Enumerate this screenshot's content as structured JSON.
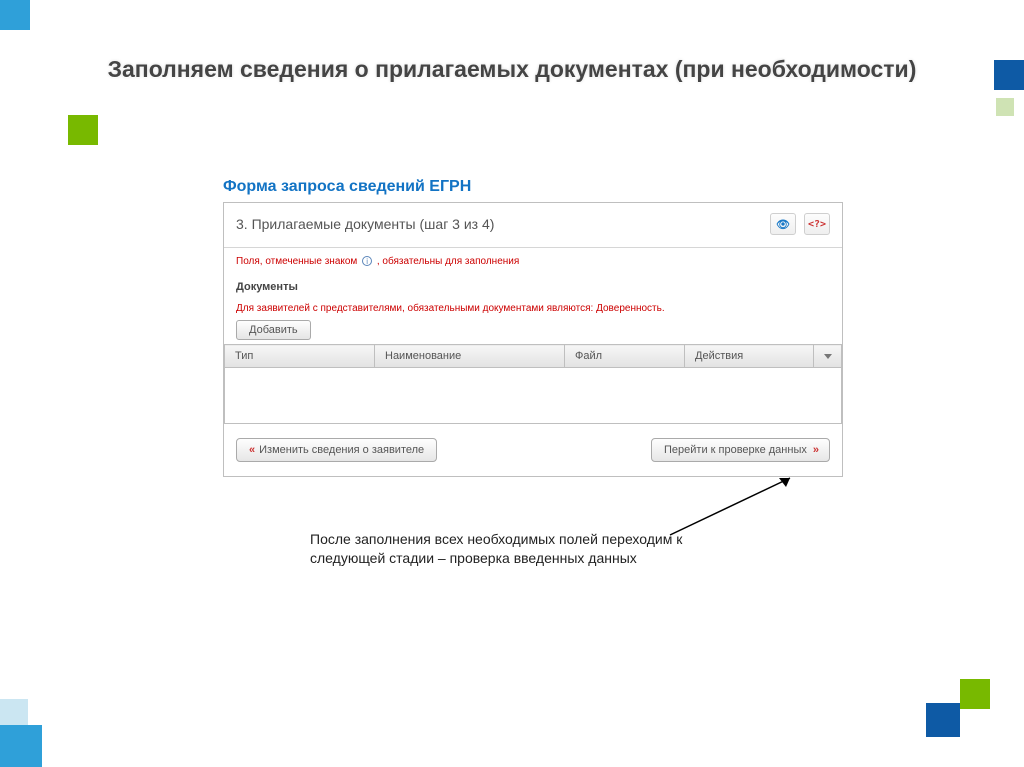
{
  "slide": {
    "title": "Заполняем сведения о прилагаемых документах (при необходимости)"
  },
  "form": {
    "title": "Форма запроса сведений ЕГРН",
    "step_header": "3. Прилагаемые документы (шаг 3 из 4)",
    "required_hint_before": "Поля, отмеченные знаком",
    "required_hint_after": ", обязательны для заполнения",
    "section_label": "Документы",
    "rep_note": "Для заявителей с представителями, обязательными документами являются: Доверенность.",
    "add_label": "Добавить",
    "cols": {
      "type": "Тип",
      "name": "Наименование",
      "file": "Файл",
      "actions": "Действия"
    },
    "back_label": "Изменить сведения о заявителе",
    "next_label": "Перейти к проверке данных"
  },
  "caption": "После заполнения всех необходимых полей переходим к следующей стадии – проверка введенных данных",
  "glyphs": {
    "info": "i"
  }
}
